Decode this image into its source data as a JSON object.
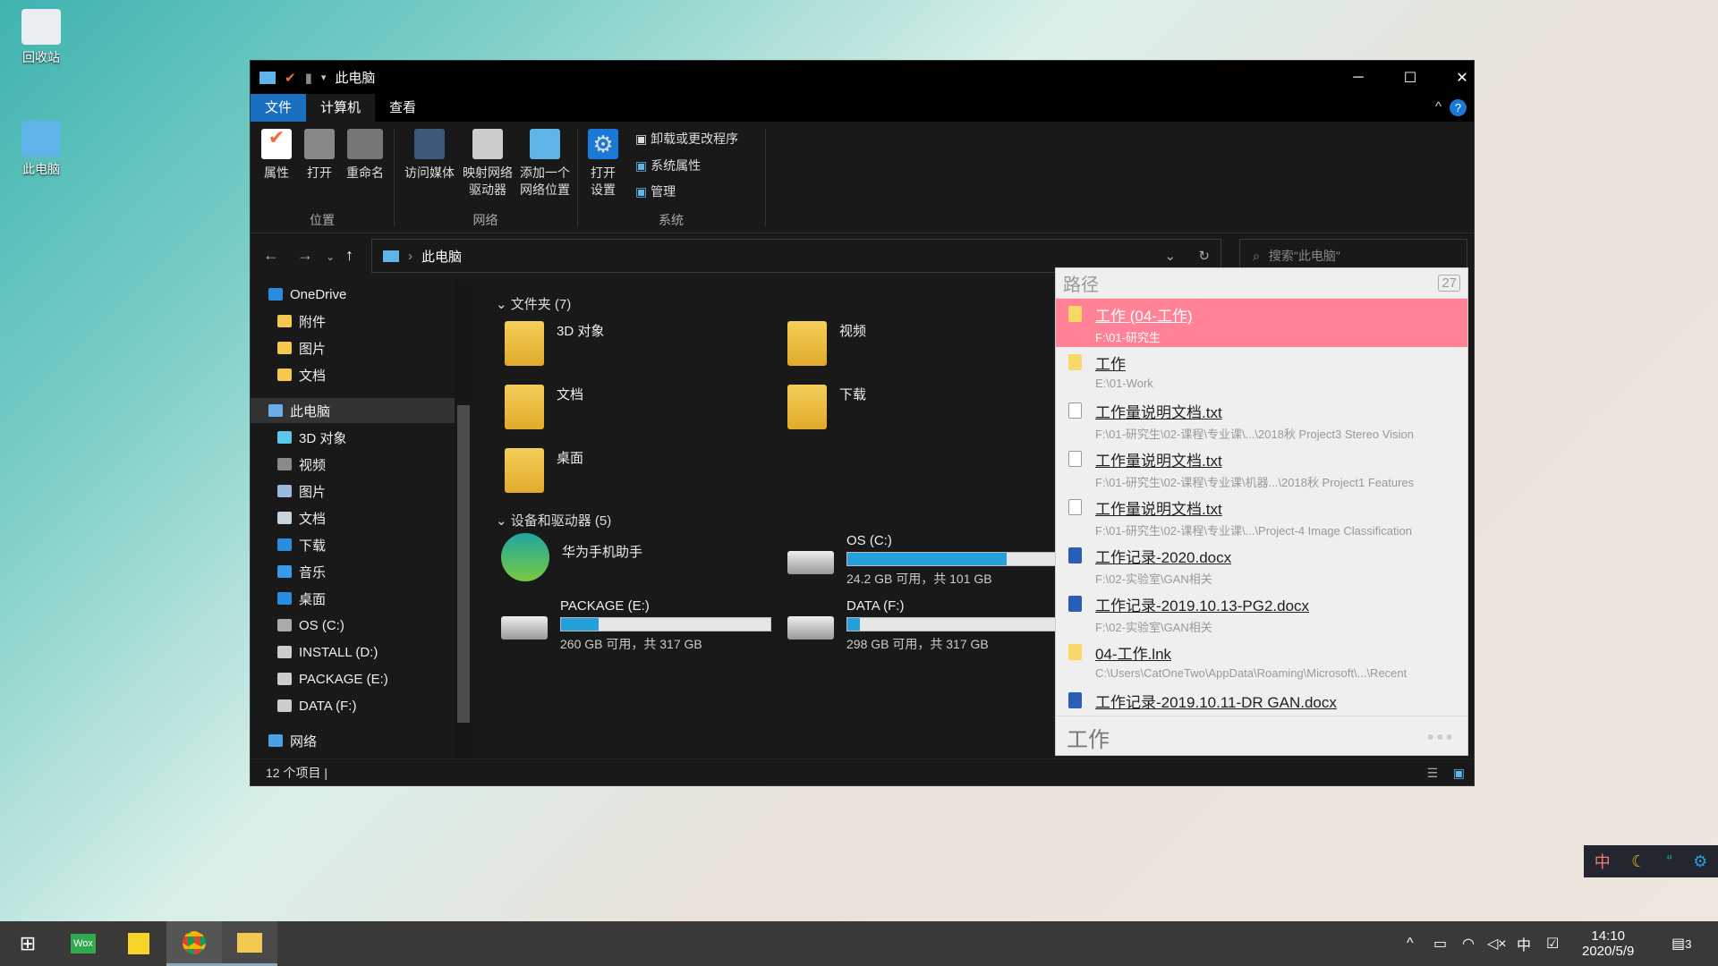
{
  "desktop": {
    "icons": [
      {
        "label": "回收站"
      },
      {
        "label": "此电脑"
      }
    ]
  },
  "window": {
    "title": "此电脑",
    "controls": {
      "minimize": "─",
      "maximize": "☐",
      "close": "✕"
    },
    "tabs": [
      {
        "label": "文件"
      },
      {
        "label": "计算机"
      },
      {
        "label": "查看"
      }
    ],
    "ribbon": {
      "location": {
        "group": "位置",
        "buttons": [
          "属性",
          "打开",
          "重命名"
        ]
      },
      "network": {
        "group": "网络",
        "buttons": [
          "访问媒体",
          "映射网络\n驱动器",
          "添加一个\n网络位置"
        ]
      },
      "system": {
        "group": "系统",
        "open_settings": "打开\n设置",
        "items": [
          "卸载或更改程序",
          "系统属性",
          "管理"
        ]
      }
    },
    "address": {
      "path": "此电脑",
      "search_placeholder": "搜索\"此电脑\""
    },
    "sidebar": [
      {
        "label": "OneDrive",
        "color": "#2b8de0"
      },
      {
        "label": "附件",
        "color": "#f3c94f"
      },
      {
        "label": "图片",
        "color": "#f3c94f"
      },
      {
        "label": "文档",
        "color": "#f3c94f"
      },
      {
        "label": "此电脑",
        "color": "#6aaee8",
        "selected": true
      },
      {
        "label": "3D 对象",
        "color": "#5cc7e8"
      },
      {
        "label": "视频",
        "color": "#8a8a8a"
      },
      {
        "label": "图片",
        "color": "#9bb9d8"
      },
      {
        "label": "文档",
        "color": "#c8d3de"
      },
      {
        "label": "下载",
        "color": "#2b8de0"
      },
      {
        "label": "音乐",
        "color": "#3b9ae8"
      },
      {
        "label": "桌面",
        "color": "#2b8de0"
      },
      {
        "label": "OS (C:)",
        "color": "#aaa"
      },
      {
        "label": "INSTALL (D:)",
        "color": "#ccc"
      },
      {
        "label": "PACKAGE (E:)",
        "color": "#ccc"
      },
      {
        "label": "DATA (F:)",
        "color": "#ccc"
      },
      {
        "label": "网络",
        "color": "#4aa0e8"
      }
    ],
    "folders_header": "文件夹 (7)",
    "folders": [
      "3D 对象",
      "视频",
      "文档",
      "下载",
      "桌面"
    ],
    "devices_header": "设备和驱动器 (5)",
    "devices": [
      {
        "name": "华为手机助手"
      },
      {
        "name": "OS (C:)",
        "free": "24.2 GB 可用，共 101 GB",
        "used_fraction": 0.76
      },
      {
        "name": "PACKAGE (E:)",
        "free": "260 GB 可用，共 317 GB",
        "used_fraction": 0.18
      },
      {
        "name": "DATA (F:)",
        "free": "298 GB 可用，共 317 GB",
        "used_fraction": 0.06
      }
    ],
    "status": "12 个项目"
  },
  "wox": {
    "header": "路径",
    "count": "27",
    "query": "工作",
    "more": "●●●",
    "results": [
      {
        "title": "工作 (04-工作)",
        "sub": "F:\\01-研究生",
        "icon": "folder",
        "selected": true
      },
      {
        "title": "工作",
        "sub": "E:\\01-Work",
        "icon": "folder"
      },
      {
        "title": "工作量说明文档.txt",
        "sub": "F:\\01-研究生\\02-课程\\专业课\\...\\2018秋 Project3 Stereo Vision",
        "icon": "txt"
      },
      {
        "title": "工作量说明文档.txt",
        "sub": "F:\\01-研究生\\02-课程\\专业课\\机器...\\2018秋 Project1 Features",
        "icon": "txt"
      },
      {
        "title": "工作量说明文档.txt",
        "sub": "F:\\01-研究生\\02-课程\\专业课\\...\\Project-4 Image Classification",
        "icon": "txt"
      },
      {
        "title": "工作记录-2020.docx",
        "sub": "F:\\02-实验室\\GAN相关",
        "icon": "word"
      },
      {
        "title": "工作记录-2019.10.13-PG2.docx",
        "sub": "F:\\02-实验室\\GAN相关",
        "icon": "word"
      },
      {
        "title": "04-工作.lnk",
        "sub": "C:\\Users\\CatOneTwo\\AppData\\Roaming\\Microsoft\\...\\Recent",
        "icon": "folder"
      },
      {
        "title": "工作记录-2019.10.11-DR GAN.docx",
        "sub": "",
        "icon": "word"
      }
    ]
  },
  "ime_toolbar": [
    "中",
    "☾",
    "“",
    "⚙"
  ],
  "taskbar": {
    "apps": [
      "Start",
      "Wox",
      "Sticky Notes",
      "Chrome",
      "File Explorer"
    ],
    "wox_label": "Wox",
    "time": "14:10",
    "date": "2020/5/9",
    "tray_ime": "中",
    "notifications": "3"
  }
}
